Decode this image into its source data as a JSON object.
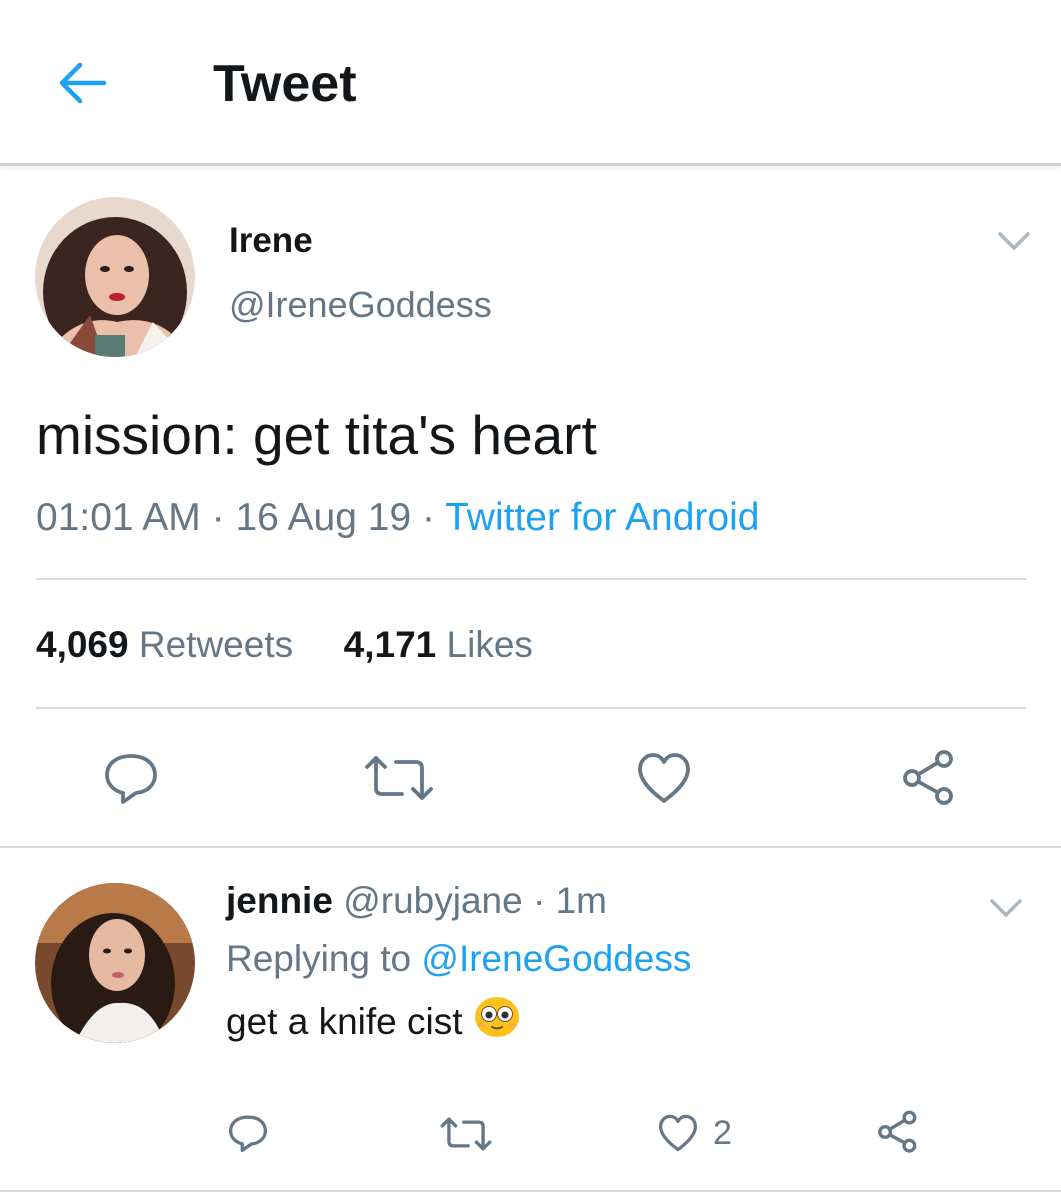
{
  "header": {
    "title": "Tweet"
  },
  "tweet": {
    "author_name": "Irene",
    "author_handle": "@IreneGoddess",
    "text": "mission: get tita's heart",
    "time": "01:01 AM",
    "separator": "·",
    "date": "16 Aug 19",
    "source": "Twitter for Android",
    "retweets_count": "4,069",
    "retweets_label": "Retweets",
    "likes_count": "4,171",
    "likes_label": "Likes"
  },
  "reply": {
    "author_name": "jennie",
    "author_handle": "@rubyjane",
    "separator": "·",
    "time": "1m",
    "replying_to_label": "Replying to",
    "replying_to_handle": "@IreneGoddess",
    "text": "get a knife cist",
    "emoji": "flushed-face-emoji",
    "likes_count": "2"
  },
  "icons": {
    "back": "arrow-left-icon",
    "caret": "chevron-down-icon",
    "reply": "reply-bubble-icon",
    "retweet": "retweet-icon",
    "like": "heart-icon",
    "share": "share-icon"
  },
  "colors": {
    "accent": "#1da1f2",
    "text": "#14171a",
    "secondary": "#657786",
    "divider": "#d4dbe1"
  }
}
